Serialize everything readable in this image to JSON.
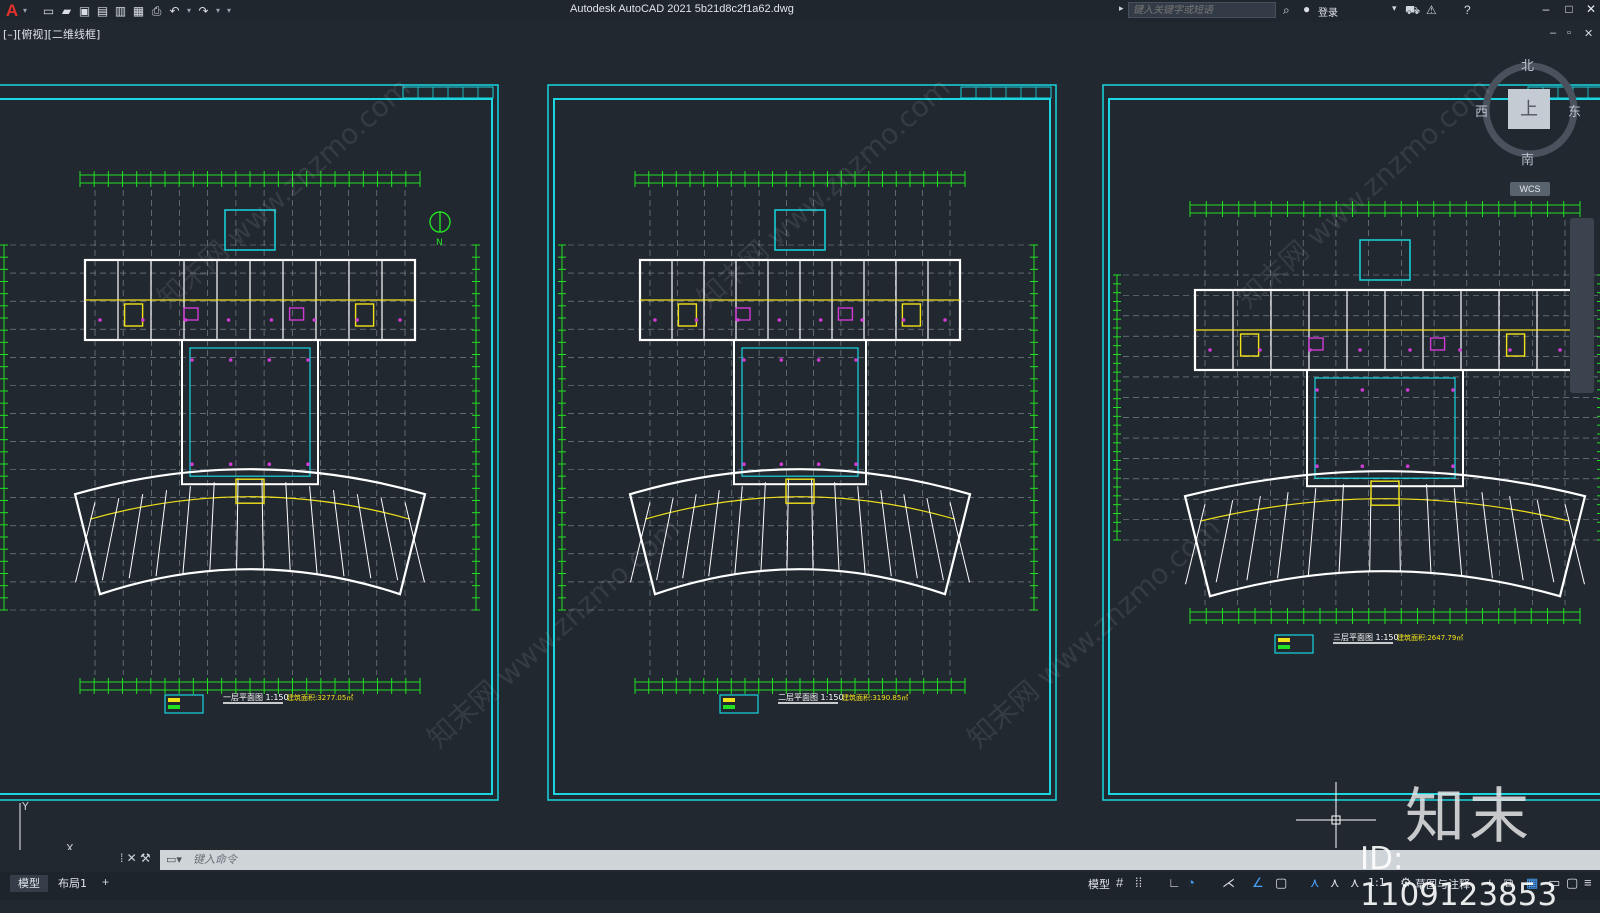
{
  "app": {
    "icon_letter": "A",
    "title": "Autodesk AutoCAD 2021    5b21d8c2f1a62.dwg"
  },
  "quick_access": {
    "new_icon": "new-file-icon",
    "open_icon": "open-folder-icon",
    "save_icon": "save-icon",
    "saveas_icon": "save-as-icon",
    "plot_icon": "plot-icon",
    "undo_icon": "undo-icon",
    "redo_icon": "redo-icon"
  },
  "search": {
    "placeholder": "键入关键字或短语",
    "login_label": "登录"
  },
  "viewport": {
    "label": "[–][俯视][二维线框]"
  },
  "viewcube": {
    "north": "北",
    "south": "南",
    "east": "东",
    "west": "西",
    "face": "上",
    "wcs": "WCS"
  },
  "sheets": [
    {
      "plan_title": "一层平面图 1:150",
      "area_label": "建筑面积:3277.05㎡"
    },
    {
      "plan_title": "二层平面图 1:150",
      "area_label": "建筑面积:3190.85㎡"
    },
    {
      "plan_title": "三层平面图 1:150",
      "area_label": "建筑面积:2647.79㎡"
    }
  ],
  "north_arrow_label": "N",
  "ucs": {
    "x_label": "X",
    "y_label": "Y"
  },
  "command": {
    "placeholder": "键入命令"
  },
  "layout_tabs": [
    {
      "label": "模型",
      "active": true
    },
    {
      "label": "布局1",
      "active": false
    }
  ],
  "add_tab": "+",
  "status": {
    "model_label": "模型",
    "scale_label": "1:1",
    "workspace_label": "草图与注释"
  },
  "watermark": {
    "logo": "知末",
    "id_text": "ID: 1109123853",
    "diag_text": "知末网 www.znzmo.com"
  },
  "colors": {
    "background": "#212830",
    "frame": "#19d6e0",
    "walls": "#ffffff",
    "dimensions": "#22e022",
    "accent_yellow": "#f2e21a",
    "accent_magenta": "#d23ad6"
  }
}
